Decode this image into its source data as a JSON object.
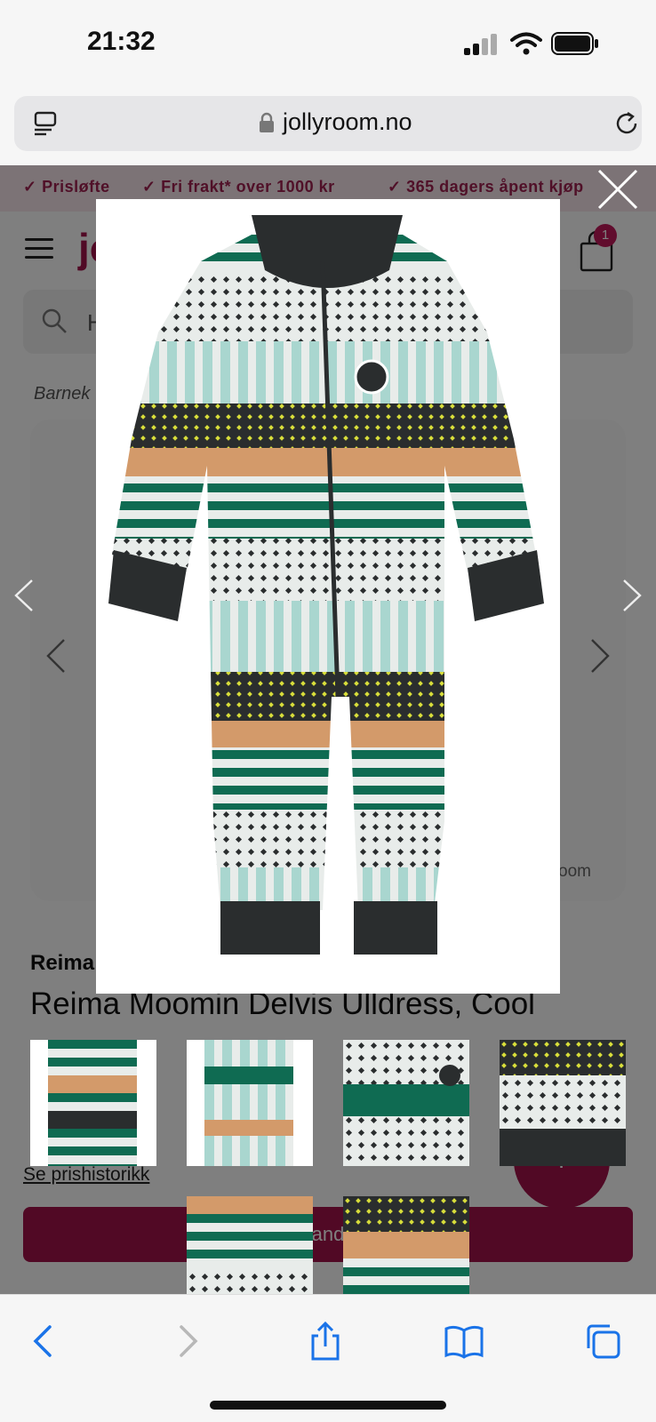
{
  "status": {
    "time": "21:32"
  },
  "browser": {
    "domain": "jollyroom.no"
  },
  "promo": {
    "items": [
      "✓ Prisløfte",
      "✓ Fri frakt* over 1000 kr",
      "✓ 365 dagers åpent kjøp"
    ]
  },
  "header": {
    "logo_fragment": "jo",
    "cart_count": "1"
  },
  "search": {
    "placeholder_fragment": "H"
  },
  "breadcrumb": {
    "fragment": "Barnek"
  },
  "gallery": {
    "watermark_fragment": "oom"
  },
  "product": {
    "brand_fragment": "Reima",
    "title": "Reima Moomin Delvis Ulldress, Cool",
    "price_history_link": "Se prishistorikk",
    "add_to_cart_fragment": "and",
    "help_label": "?"
  },
  "colors": {
    "brand": "#a3124a",
    "stripe_green": "#0f6b52",
    "stripe_mint": "#a9d6cf",
    "stripe_tan": "#d39a6a",
    "dark": "#2a2d2e",
    "dot_yellow": "#d7dd3a"
  },
  "icons": {
    "status": [
      "signal-icon",
      "wifi-icon",
      "battery-icon"
    ],
    "browser": [
      "tab-overview-icon",
      "lock-icon",
      "reload-icon"
    ],
    "lightbox": [
      "close-icon",
      "chevron-left-icon",
      "chevron-right-icon"
    ],
    "toolbar": [
      "back-icon",
      "forward-icon",
      "share-icon",
      "bookmarks-icon",
      "tabs-icon"
    ]
  }
}
